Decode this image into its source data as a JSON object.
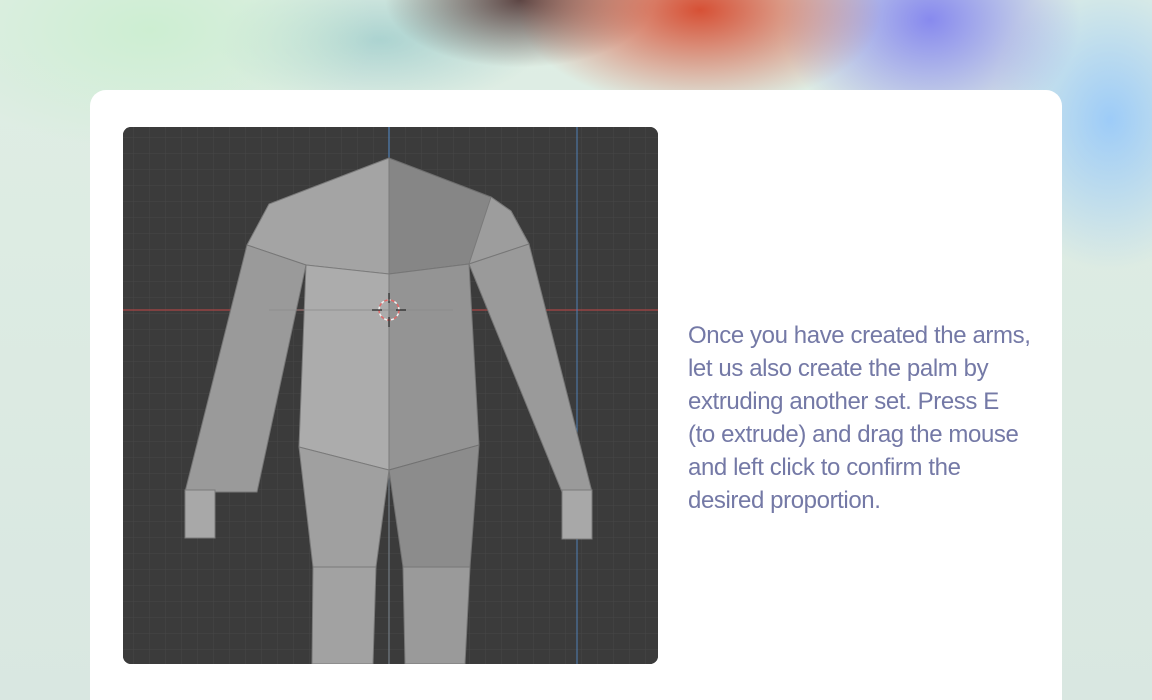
{
  "tutorial": {
    "description_lines": [
      "Once you have created the arms,",
      "let us also create the palm by",
      "extruding another set. Press E",
      "(to extrude) and drag the mouse",
      "and left click to confirm the",
      "desired proportion."
    ]
  },
  "viewport": {
    "model_icon": "humanoid-mesh-icon",
    "cursor_icon": "3d-cursor-icon"
  },
  "colors": {
    "text": "#7479a6",
    "card": "#ffffff",
    "viewport_bg": "#3b3b3b",
    "x_axis": "#b34a4a",
    "y_axis": "#4f7fb5"
  }
}
